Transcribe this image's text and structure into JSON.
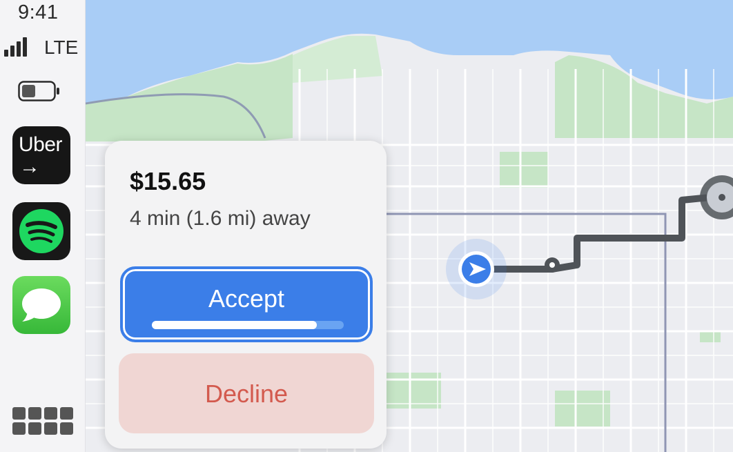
{
  "status_bar": {
    "time": "9:41",
    "network": "LTE",
    "signal_bars": 4,
    "battery_level": 0.45
  },
  "dock": {
    "apps": [
      {
        "name": "Uber",
        "label": "Uber",
        "arrow": "→",
        "icon": "uber-icon"
      },
      {
        "name": "Spotify",
        "icon": "spotify-icon"
      },
      {
        "name": "Messages",
        "icon": "messages-icon"
      }
    ],
    "app_grid_icon": "app-grid-icon"
  },
  "offer": {
    "price": "$15.65",
    "eta": "4 min (1.6 mi) away",
    "accept_label": "Accept",
    "accept_progress": 0.86,
    "decline_label": "Decline"
  },
  "colors": {
    "accent": "#3b7ee8",
    "decline_bg": "#f0d6d3",
    "decline_text": "#d35a4e",
    "water": "#a9cdf6",
    "park": "#c6e5c6",
    "route": "#4f5358"
  },
  "map_icons": {
    "current_location": "navigation-arrow-icon",
    "destination": "destination-pin-icon"
  }
}
